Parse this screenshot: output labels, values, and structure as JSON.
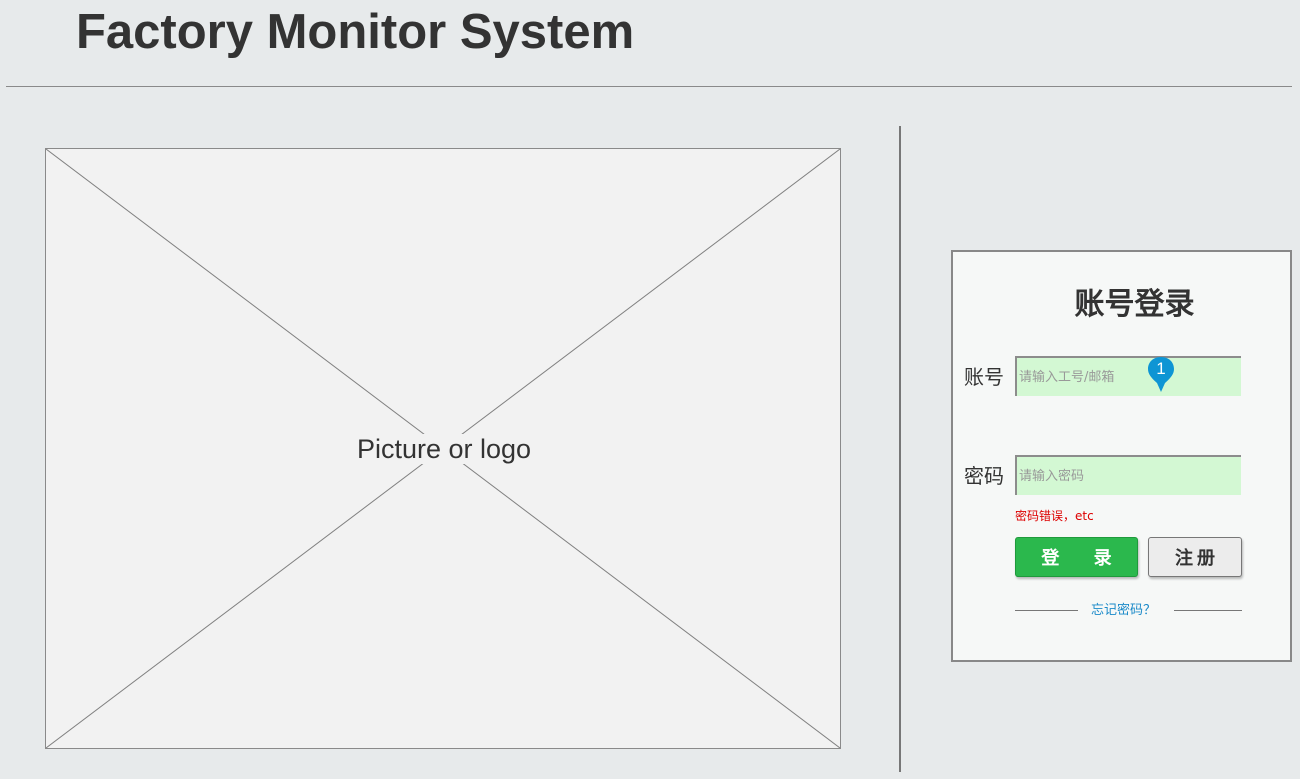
{
  "header": {
    "title": "Factory Monitor System"
  },
  "hero": {
    "placeholder_label": "Picture or logo"
  },
  "login": {
    "title": "账号登录",
    "account_label": "账号",
    "account_placeholder": "请输入工号/邮箱",
    "password_label": "密码",
    "password_placeholder": "请输入密码",
    "error_message": "密码错误，etc",
    "login_button": "登 录",
    "register_button": "注册",
    "forgot_password": "忘记密码？",
    "annotation_marker": "1"
  },
  "colors": {
    "background": "#e7eaeb",
    "input_background": "#d3f8d3",
    "login_button": "#2bb84d",
    "error_text": "#dd0000",
    "link": "#1b8ac9",
    "marker": "#0e95d4"
  }
}
